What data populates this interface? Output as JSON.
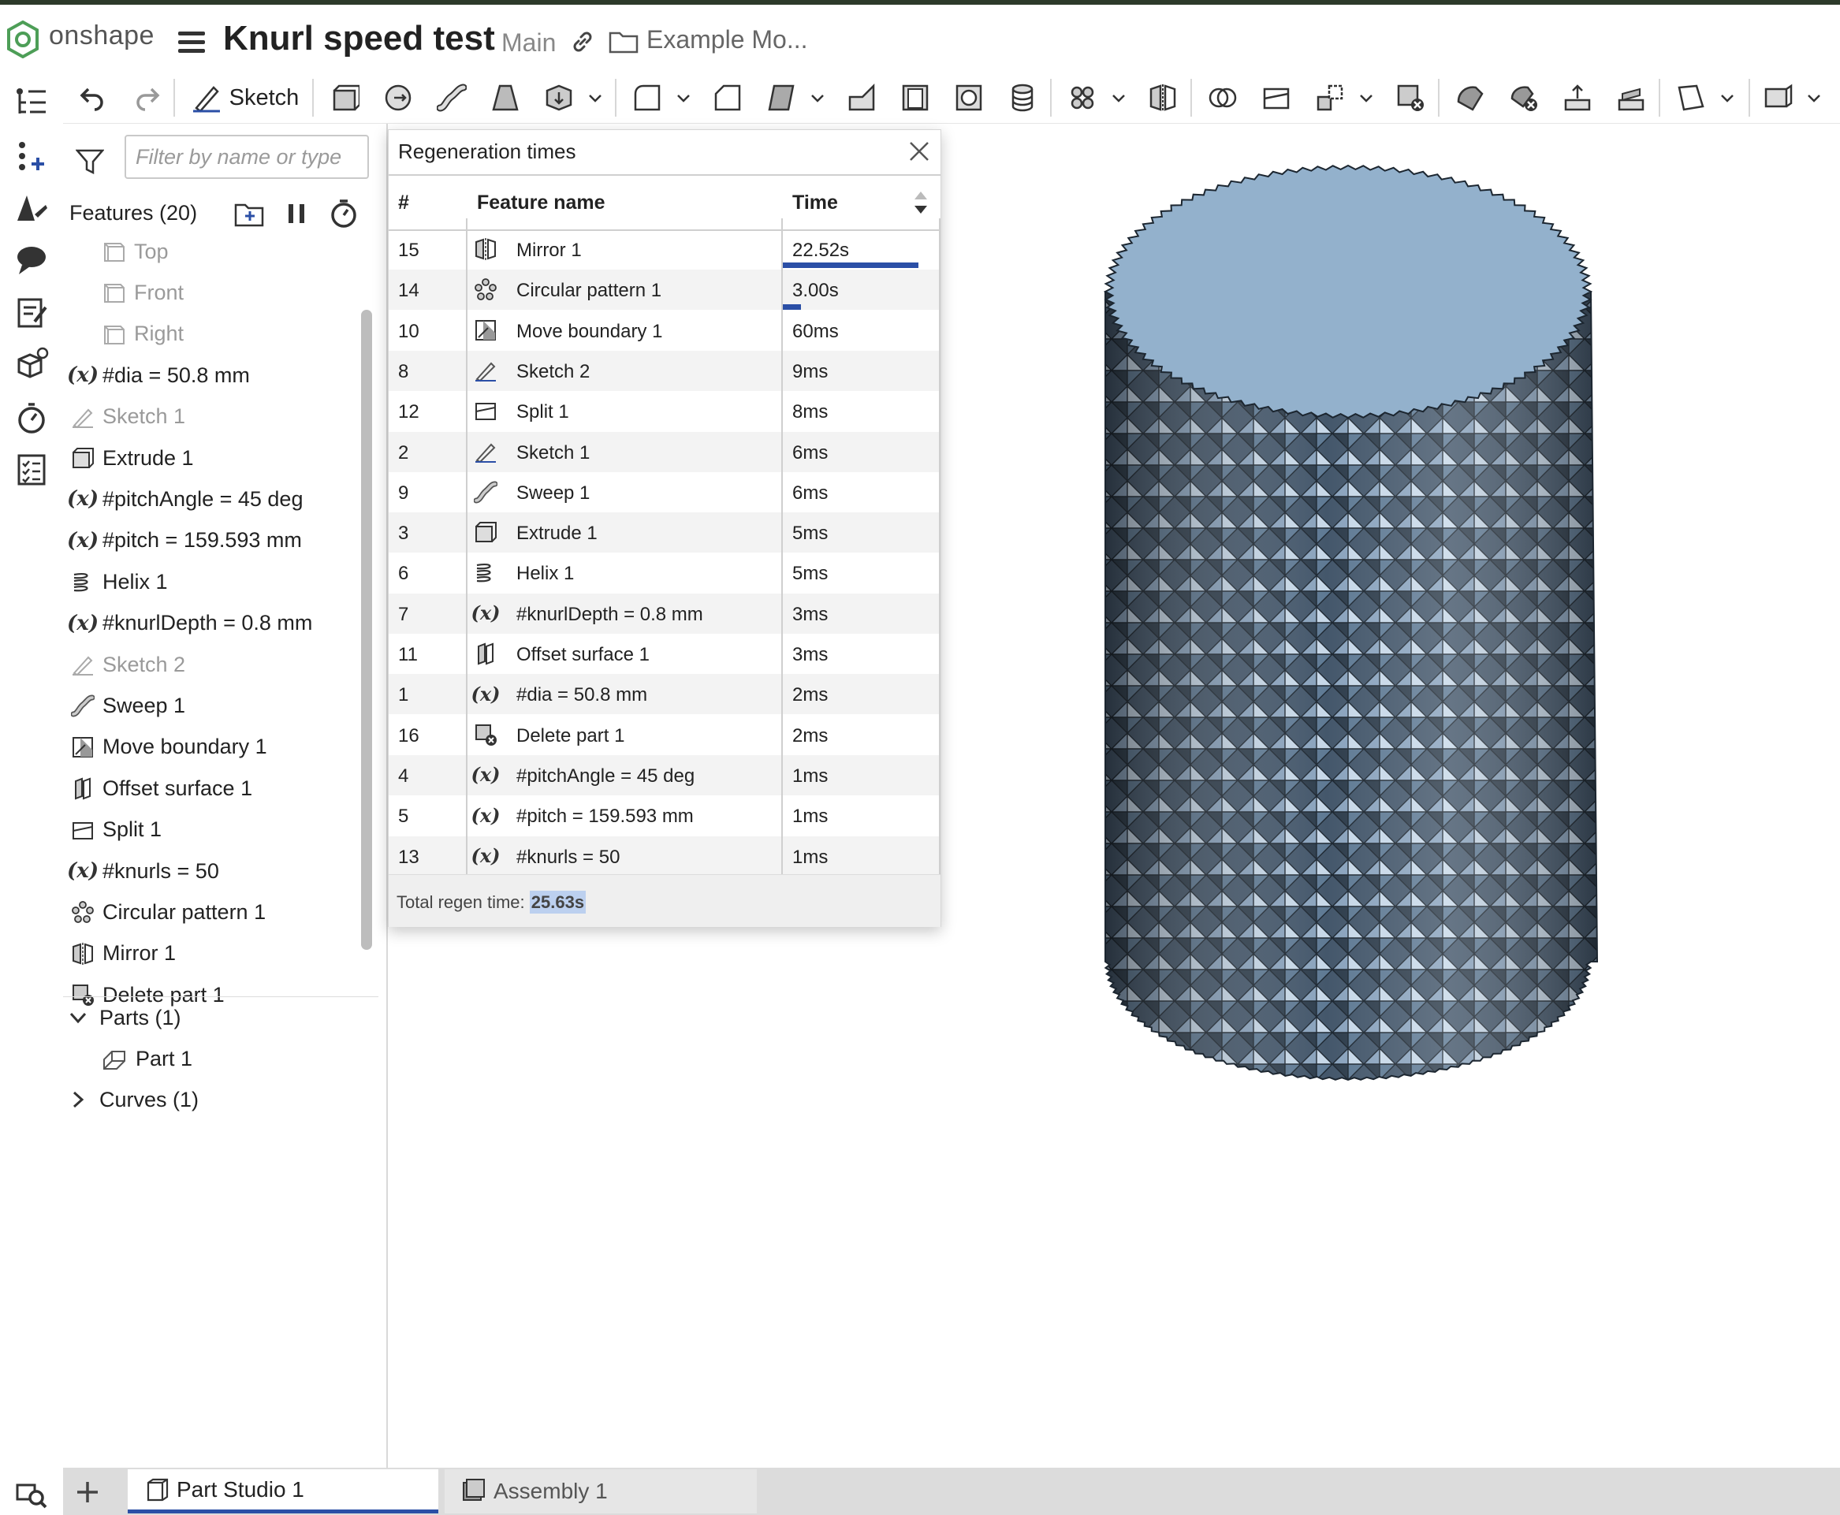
{
  "header": {
    "brand": "onshape",
    "document_title": "Knurl speed test",
    "workspace": "Main",
    "folder": "Example Mo..."
  },
  "toolbar": {
    "sketch_label": "Sketch"
  },
  "feature_panel": {
    "filter_placeholder": "Filter by name or type",
    "features_title": "Features (20)",
    "features": [
      {
        "label": "Top",
        "icon": "plane-icon",
        "state": "dim"
      },
      {
        "label": "Front",
        "icon": "plane-icon",
        "state": "dim"
      },
      {
        "label": "Right",
        "icon": "plane-icon",
        "state": "dim"
      },
      {
        "label": "#dia = 50.8 mm",
        "icon": "variable-icon"
      },
      {
        "label": "Sketch 1",
        "icon": "sketch-icon",
        "state": "dim"
      },
      {
        "label": "Extrude 1",
        "icon": "extrude-icon"
      },
      {
        "label": "#pitchAngle = 45 deg",
        "icon": "variable-icon"
      },
      {
        "label": "#pitch = 159.593 mm",
        "icon": "variable-icon"
      },
      {
        "label": "Helix 1",
        "icon": "helix-icon"
      },
      {
        "label": "#knurlDepth = 0.8 mm",
        "icon": "variable-icon"
      },
      {
        "label": "Sketch 2",
        "icon": "sketch-icon",
        "state": "dim"
      },
      {
        "label": "Sweep 1",
        "icon": "sweep-icon"
      },
      {
        "label": "Move boundary 1",
        "icon": "move-boundary-icon"
      },
      {
        "label": "Offset surface 1",
        "icon": "offset-surface-icon"
      },
      {
        "label": "Split 1",
        "icon": "split-icon"
      },
      {
        "label": "#knurls = 50",
        "icon": "variable-icon"
      },
      {
        "label": "Circular pattern 1",
        "icon": "circular-pattern-icon"
      },
      {
        "label": "Mirror 1",
        "icon": "mirror-icon"
      },
      {
        "label": "Delete part 1",
        "icon": "delete-part-icon"
      }
    ],
    "parts_label": "Parts (1)",
    "part_label": "Part 1",
    "curves_label": "Curves (1)"
  },
  "regen_dialog": {
    "title": "Regeneration times",
    "columns": [
      "#",
      "Feature name",
      "Time"
    ],
    "rows": [
      {
        "num": "15",
        "name": "Mirror 1",
        "time": "22.52s",
        "icon": "mirror-icon",
        "bar_fraction": 0.879
      },
      {
        "num": "14",
        "name": "Circular pattern 1",
        "time": "3.00s",
        "icon": "circular-pattern-icon",
        "bar_fraction": 0.117
      },
      {
        "num": "10",
        "name": "Move boundary 1",
        "time": "60ms",
        "icon": "move-boundary-icon"
      },
      {
        "num": "8",
        "name": "Sketch 2",
        "time": "9ms",
        "icon": "sketch-icon"
      },
      {
        "num": "12",
        "name": "Split 1",
        "time": "8ms",
        "icon": "split-icon"
      },
      {
        "num": "2",
        "name": "Sketch 1",
        "time": "6ms",
        "icon": "sketch-icon"
      },
      {
        "num": "9",
        "name": "Sweep 1",
        "time": "6ms",
        "icon": "sweep-icon"
      },
      {
        "num": "3",
        "name": "Extrude 1",
        "time": "5ms",
        "icon": "extrude-icon"
      },
      {
        "num": "6",
        "name": "Helix 1",
        "time": "5ms",
        "icon": "helix-icon"
      },
      {
        "num": "7",
        "name": "#knurlDepth = 0.8 mm",
        "time": "3ms",
        "icon": "variable-icon"
      },
      {
        "num": "11",
        "name": "Offset surface 1",
        "time": "3ms",
        "icon": "offset-surface-icon"
      },
      {
        "num": "1",
        "name": "#dia = 50.8 mm",
        "time": "2ms",
        "icon": "variable-icon"
      },
      {
        "num": "16",
        "name": "Delete part 1",
        "time": "2ms",
        "icon": "delete-part-icon"
      },
      {
        "num": "4",
        "name": "#pitchAngle = 45 deg",
        "time": "1ms",
        "icon": "variable-icon"
      },
      {
        "num": "5",
        "name": "#pitch = 159.593 mm",
        "time": "1ms",
        "icon": "variable-icon"
      },
      {
        "num": "13",
        "name": "#knurls = 50",
        "time": "1ms",
        "icon": "variable-icon"
      }
    ],
    "total_label": "Total regen time:",
    "total_value": "25.63s"
  },
  "tabs": [
    {
      "label": "Part Studio 1",
      "active": true
    },
    {
      "label": "Assembly 1",
      "active": false
    }
  ],
  "colors": {
    "accent_blue": "#2b4fa6",
    "part_top": "#93b1cc",
    "part_side": "#4a5d70"
  }
}
